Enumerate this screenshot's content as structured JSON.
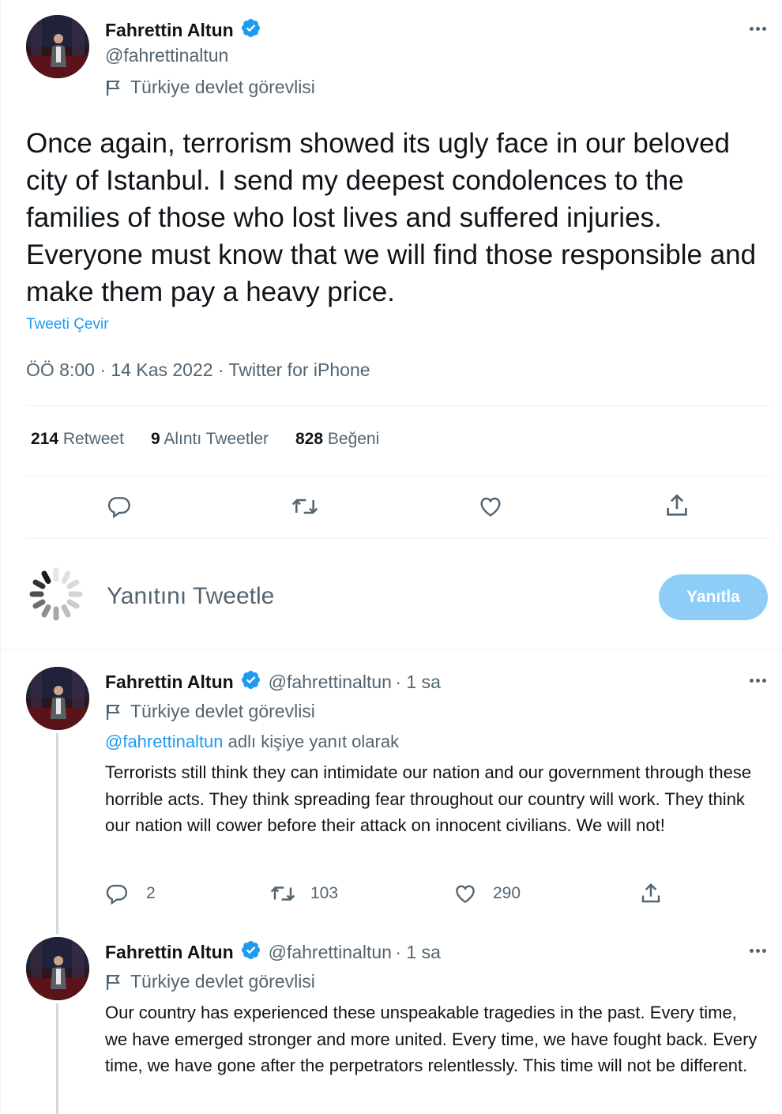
{
  "main_tweet": {
    "author_name": "Fahrettin Altun",
    "author_handle": "@fahrettinaltun",
    "account_label": "Türkiye devlet görevlisi",
    "text": "Once again, terrorism showed its ugly face in our beloved city of Istanbul. I send my deepest condolences to the families of those who lost lives and suffered injuries. Everyone must know that we will find those responsible and make them pay a heavy price.",
    "translate_label": "Tweeti Çevir",
    "timestamp": "ÖÖ 8:00 · 14 Kas 2022 · Twitter for iPhone",
    "stats": {
      "retweets_count": "214",
      "retweets_label": "Retweet",
      "quotes_count": "9",
      "quotes_label": "Alıntı Tweetler",
      "likes_count": "828",
      "likes_label": "Beğeni"
    },
    "actions": [
      "reply-icon",
      "retweet-icon",
      "like-icon",
      "share-icon"
    ]
  },
  "composer": {
    "placeholder": "Yanıtını Tweetle",
    "button_label": "Yanıtla",
    "button_color": "#8ecdf8"
  },
  "replies": [
    {
      "author_name": "Fahrettin Altun",
      "author_handle": "@fahrettinaltun",
      "time": "· 1 sa",
      "account_label": "Türkiye devlet görevlisi",
      "replying_mention": "@fahrettinaltun",
      "replying_suffix": "adlı kişiye yanıt olarak",
      "text": "Terrorists still think they can intimidate our nation and our government through these horrible acts. They think spreading fear throughout our country will work. They think our nation will cower before their attack on innocent civilians. We will not!",
      "reply_count": "2",
      "retweet_count": "103",
      "like_count": "290"
    },
    {
      "author_name": "Fahrettin Altun",
      "author_handle": "@fahrettinaltun",
      "time": "· 1 sa",
      "account_label": "Türkiye devlet görevlisi",
      "text": "Our country has experienced these unspeakable tragedies in the past. Every time, we have emerged stronger and more united. Every time, we have fought back. Every time, we have gone after the perpetrators relentlessly. This time will not be different."
    }
  ],
  "colors": {
    "link": "#1d9bf0",
    "secondary_text": "#536471",
    "verified": "#1d9bf0",
    "divider": "#eff3f4"
  }
}
